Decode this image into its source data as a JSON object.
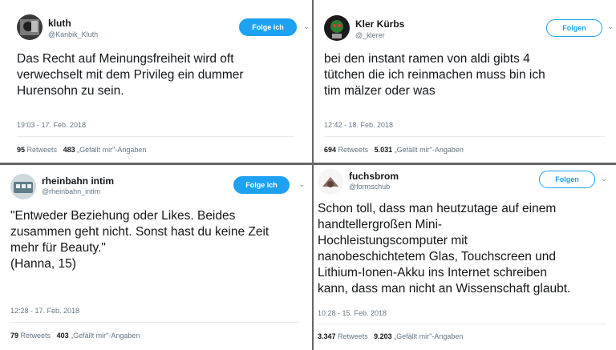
{
  "tweets": [
    {
      "name": "kluth",
      "handle": "@Kanbik_Kluth",
      "follow_label": "Folge ich",
      "text": "Das Recht auf Meinungsfreiheit wird oft\nverwechselt mit dem Privileg ein dummer\nHurensohn zu sein.",
      "timestamp": "19:03 - 17. Feb. 2018",
      "retweets": "95",
      "retweets_label": "Retweets",
      "likes": "483",
      "likes_label": "„Gefällt mir\"-Angaben"
    },
    {
      "name": "Kler Kürbs",
      "handle": "@_klerer",
      "follow_label": "Folgen",
      "text": "bei den instant ramen von aldi gibts 4\ntütchen die ich reinmachen muss bin ich\ntim mälzer oder was",
      "timestamp": "12:42 - 18. Feb. 2018",
      "retweets": "694",
      "retweets_label": "Retweets",
      "likes": "5.031",
      "likes_label": "„Gefällt mir\"-Angaben"
    },
    {
      "name": "rheinbahn intim",
      "handle": "@rheinbahn_intim",
      "follow_label": "Folge ich",
      "text": "\"Entweder Beziehung oder Likes. Beides\nzusammen geht nicht. Sonst hast du keine Zeit\nmehr für Beauty.\"\n(Hanna, 15)",
      "timestamp": "12:28 - 17. Feb. 2018",
      "retweets": "79",
      "retweets_label": "Retweets",
      "likes": "403",
      "likes_label": "„Gefällt mir\"-Angaben"
    },
    {
      "name": "fuchsbrom",
      "handle": "@formschub",
      "follow_label": "Folgen",
      "text": "Schon toll, dass man heutzutage auf einem\nhandtellergroßen Mini-\nHochleistungscomputer mit\nnanobeschichtetem Glas, Touchscreen und\nLithium-Ionen-Akku ins Internet schreiben\nkann, dass man nicht an Wissenschaft glaubt.",
      "timestamp": "10:28 - 15. Feb. 2018",
      "retweets": "3.347",
      "retweets_label": "Retweets",
      "likes": "9.203",
      "likes_label": "„Gefällt mir\"-Angaben"
    }
  ],
  "icons": {
    "chevron": "chevron-down-icon"
  }
}
